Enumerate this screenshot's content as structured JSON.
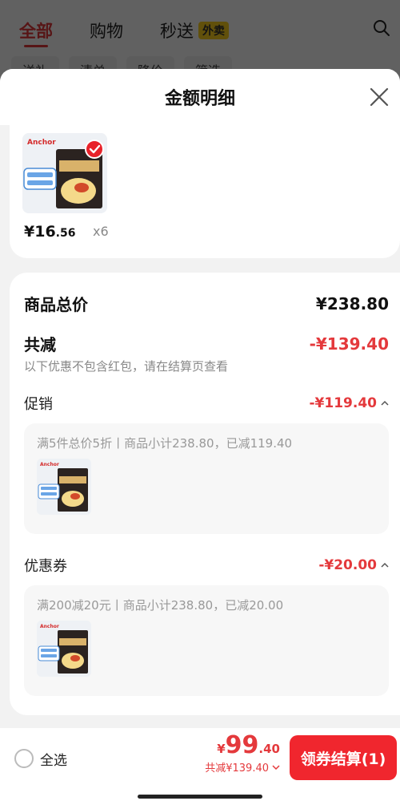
{
  "background": {
    "tabs": [
      {
        "label": "全部"
      },
      {
        "label": "购物"
      },
      {
        "label": "秒送"
      }
    ],
    "badge": "外卖",
    "chips": [
      "送礼",
      "清单",
      "降价",
      "筛选"
    ]
  },
  "sheet": {
    "title": "金额明细"
  },
  "product": {
    "brand": "Anchor",
    "price_main": "¥16",
    "price_dec": ".56",
    "qty": "x6"
  },
  "detail": {
    "subtotal_label": "商品总价",
    "subtotal_value": "¥238.80",
    "discount_label": "共减",
    "discount_value": "-¥139.40",
    "discount_note": "以下优惠不包含红包，请在结算页查看",
    "promo_label": "促销",
    "promo_value": "-¥119.40",
    "promo_desc": "满5件总价5折丨商品小计238.80，已减119.40",
    "coupon_label": "优惠券",
    "coupon_value": "-¥20.00",
    "coupon_desc": "满200减20元丨商品小计238.80，已减20.00"
  },
  "footer": {
    "select_all": "全选",
    "total_symbol": "¥",
    "total_int": "99",
    "total_dec": ".40",
    "total_saved": "共减¥139.40",
    "checkout_label": "领券结算(1)"
  },
  "colors": {
    "accent": "#e4393c",
    "checkout": "#f0262e"
  }
}
